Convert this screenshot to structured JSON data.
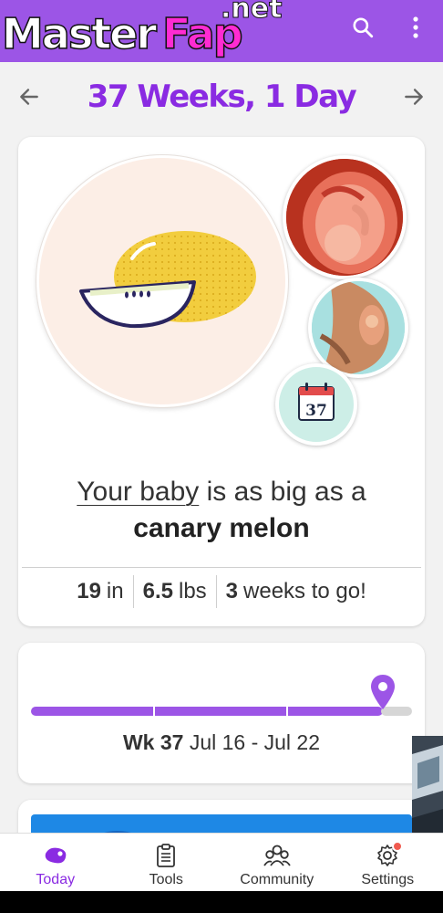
{
  "watermark": {
    "master": "Master",
    "fap": "Fap",
    "net": ".net"
  },
  "appbar": {
    "bg_color": "#9c55e6",
    "actions": [
      "search-icon",
      "more-vert-icon"
    ]
  },
  "week_nav": {
    "title": "37 Weeks, 1 Day",
    "prev_icon": "arrow-left-icon",
    "next_icon": "arrow-right-icon"
  },
  "size": {
    "link_text": "Your baby",
    "rest_text": " is as big as a",
    "fruit": "canary melon"
  },
  "stats": [
    {
      "value": "19",
      "unit": "in"
    },
    {
      "value": "6.5",
      "unit": "lbs"
    },
    {
      "value": "3",
      "unit": "weeks to go!"
    }
  ],
  "calendar_badge": "37",
  "timeline": {
    "progress": 0.93,
    "week_label": "Wk 37",
    "date_range": "Jul 16 - Jul 22"
  },
  "bottom_nav": [
    {
      "label": "Today",
      "icon": "today-icon",
      "active": true
    },
    {
      "label": "Tools",
      "icon": "clipboard-icon",
      "active": false
    },
    {
      "label": "Community",
      "icon": "community-icon",
      "active": false
    },
    {
      "label": "Settings",
      "icon": "gear-icon",
      "active": false,
      "badge": true
    }
  ],
  "colors": {
    "accent": "#8a2be2",
    "track": "#9c55e6",
    "badge": "#f05a4f"
  }
}
